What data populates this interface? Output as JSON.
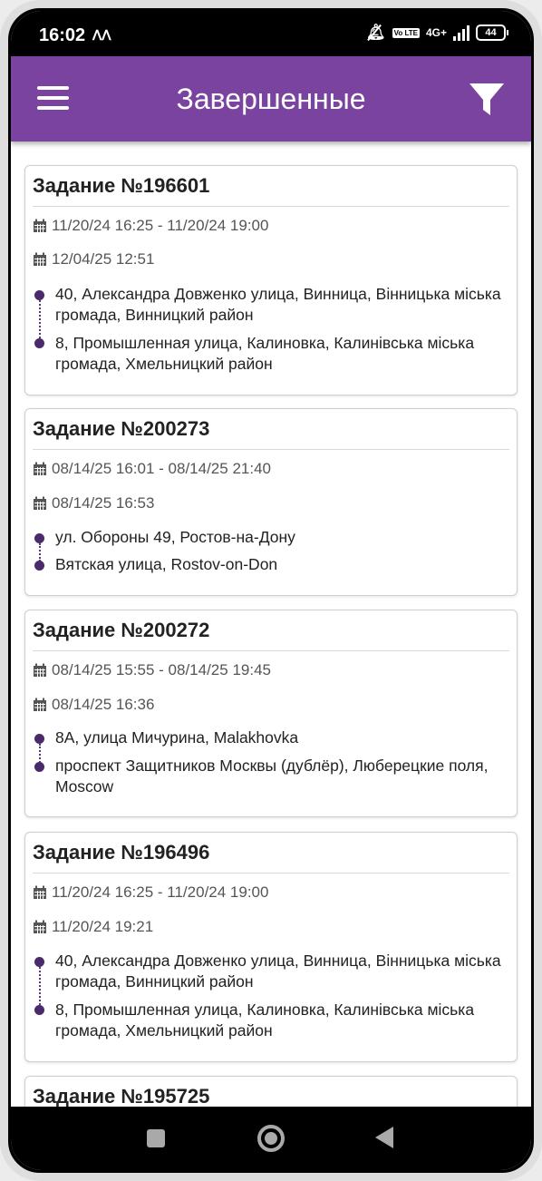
{
  "status_bar": {
    "time": "16:02",
    "network": "4G+",
    "volte": "Vo LTE",
    "battery": "44"
  },
  "app_bar": {
    "title": "Завершенные",
    "menu_icon": "hamburger-menu-icon",
    "filter_icon": "filter-funnel-icon",
    "color": "#7b43a0"
  },
  "tasks": [
    {
      "title": "Задание №196601",
      "period": "11/20/24 16:25 - 11/20/24 19:00",
      "completed": "12/04/25 12:51",
      "from": "40, Александра Довженко улица, Винница, Вінницька міська громада, Винницкий район",
      "to": "8, Промышленная улица, Калиновка, Калинівська міська громада, Хмельницкий район"
    },
    {
      "title": "Задание №200273",
      "period": "08/14/25 16:01 - 08/14/25 21:40",
      "completed": "08/14/25 16:53",
      "from": "ул. Обороны 49, Ростов-на-Дону",
      "to": "Вятская улица, Rostov-on-Don"
    },
    {
      "title": "Задание №200272",
      "period": "08/14/25 15:55 - 08/14/25 19:45",
      "completed": "08/14/25 16:36",
      "from": "8А, улица Мичурина, Malakhovka",
      "to": "проспект Защитников Москвы (дублёр), Люберецкие поля, Moscow"
    },
    {
      "title": "Задание №196496",
      "period": "11/20/24 16:25 - 11/20/24 19:00",
      "completed": "11/20/24 19:21",
      "from": "40, Александра Довженко улица, Винница, Вінницька міська громада, Винницкий район",
      "to": "8, Промышленная улица, Калиновка, Калинівська міська громада, Хмельницкий район"
    },
    {
      "title": "Задание №195725"
    }
  ],
  "nav_bar": {
    "recents_icon": "square-recents-icon",
    "home_icon": "circle-home-icon",
    "back_icon": "triangle-back-icon"
  }
}
